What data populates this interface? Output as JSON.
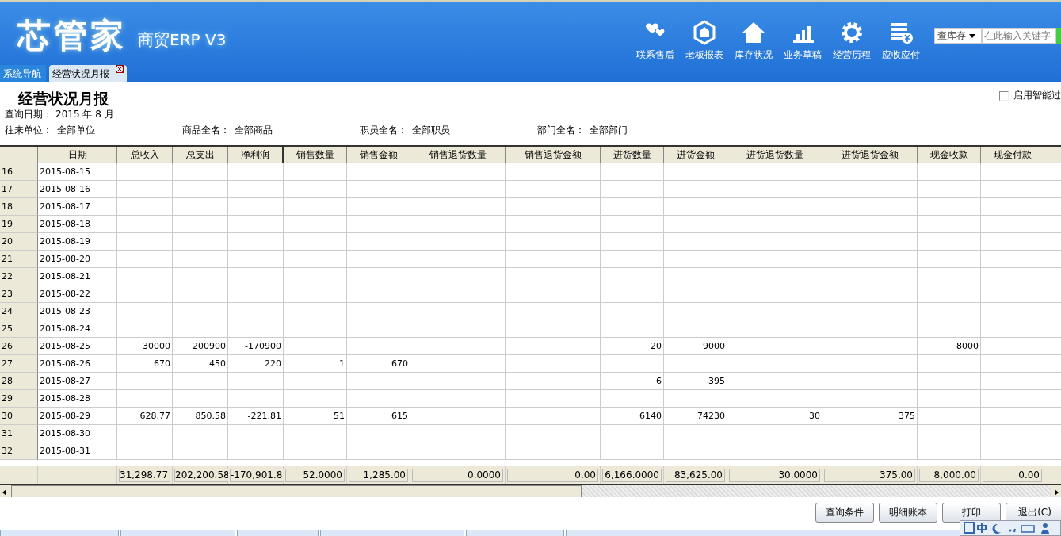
{
  "header": {
    "logo": "芯管家",
    "product": "商贸ERP V3",
    "toolbar": [
      {
        "label": "联系售后"
      },
      {
        "label": "老板报表"
      },
      {
        "label": "库存状况"
      },
      {
        "label": "业务草稿"
      },
      {
        "label": "经营历程"
      },
      {
        "label": "应收应付"
      }
    ],
    "search": {
      "scope": "查库存",
      "placeholder": "在此输入关键字"
    }
  },
  "tabs": [
    {
      "label": "系统导航",
      "selected": false,
      "closable": false
    },
    {
      "label": "经营状况月报",
      "selected": true,
      "closable": true
    }
  ],
  "report": {
    "title": "经营状况月报",
    "smart_filter": {
      "label": "启用智能过",
      "checked": false
    },
    "query_date": {
      "label": "查询日期：",
      "value": "2015 年 8 月"
    },
    "filters": [
      {
        "label": "往来单位：",
        "value": "全部单位"
      },
      {
        "label": "商品全名：",
        "value": "全部商品"
      },
      {
        "label": "职员全名：",
        "value": "全部职员"
      },
      {
        "label": "部门全名：",
        "value": "全部部门"
      }
    ]
  },
  "table": {
    "columns": [
      "日期",
      "总收入",
      "总支出",
      "净利润",
      "销售数量",
      "销售金额",
      "销售退货数量",
      "销售退货金额",
      "进货数量",
      "进货金额",
      "进货退货数量",
      "进货退货金额",
      "现金收款",
      "现金付款"
    ],
    "rows": [
      {
        "number": "16",
        "cells": [
          "2015-08-15",
          null,
          null,
          null,
          null,
          null,
          null,
          null,
          null,
          null,
          null,
          null,
          null,
          null
        ]
      },
      {
        "number": "17",
        "cells": [
          "2015-08-16",
          null,
          null,
          null,
          null,
          null,
          null,
          null,
          null,
          null,
          null,
          null,
          null,
          null
        ]
      },
      {
        "number": "18",
        "cells": [
          "2015-08-17",
          null,
          null,
          null,
          null,
          null,
          null,
          null,
          null,
          null,
          null,
          null,
          null,
          null
        ]
      },
      {
        "number": "19",
        "cells": [
          "2015-08-18",
          null,
          null,
          null,
          null,
          null,
          null,
          null,
          null,
          null,
          null,
          null,
          null,
          null
        ]
      },
      {
        "number": "20",
        "cells": [
          "2015-08-19",
          null,
          null,
          null,
          null,
          null,
          null,
          null,
          null,
          null,
          null,
          null,
          null,
          null
        ]
      },
      {
        "number": "21",
        "cells": [
          "2015-08-20",
          null,
          null,
          null,
          null,
          null,
          null,
          null,
          null,
          null,
          null,
          null,
          null,
          null
        ]
      },
      {
        "number": "22",
        "cells": [
          "2015-08-21",
          null,
          null,
          null,
          null,
          null,
          null,
          null,
          null,
          null,
          null,
          null,
          null,
          null
        ]
      },
      {
        "number": "23",
        "cells": [
          "2015-08-22",
          null,
          null,
          null,
          null,
          null,
          null,
          null,
          null,
          null,
          null,
          null,
          null,
          null
        ]
      },
      {
        "number": "24",
        "cells": [
          "2015-08-23",
          null,
          null,
          null,
          null,
          null,
          null,
          null,
          null,
          null,
          null,
          null,
          null,
          null
        ]
      },
      {
        "number": "25",
        "cells": [
          "2015-08-24",
          null,
          null,
          null,
          null,
          null,
          null,
          null,
          null,
          null,
          null,
          null,
          null,
          null
        ]
      },
      {
        "number": "26",
        "cells": [
          "2015-08-25",
          "30000",
          "200900",
          "-170900",
          null,
          null,
          null,
          null,
          "20",
          "9000",
          null,
          null,
          "8000",
          null
        ]
      },
      {
        "number": "27",
        "cells": [
          "2015-08-26",
          "670",
          "450",
          "220",
          "1",
          "670",
          null,
          null,
          null,
          null,
          null,
          null,
          null,
          null
        ]
      },
      {
        "number": "28",
        "cells": [
          "2015-08-27",
          null,
          null,
          null,
          null,
          null,
          null,
          null,
          "6",
          "395",
          null,
          null,
          null,
          null
        ]
      },
      {
        "number": "29",
        "cells": [
          "2015-08-28",
          null,
          null,
          null,
          null,
          null,
          null,
          null,
          null,
          null,
          null,
          null,
          null,
          null
        ]
      },
      {
        "number": "30",
        "cells": [
          "2015-08-29",
          "628.77",
          "850.58",
          "-221.81",
          "51",
          "615",
          null,
          null,
          "6140",
          "74230",
          "30",
          "375",
          null,
          null
        ]
      },
      {
        "number": "31",
        "cells": [
          "2015-08-30",
          null,
          null,
          null,
          null,
          null,
          null,
          null,
          null,
          null,
          null,
          null,
          null,
          null
        ]
      },
      {
        "number": "32",
        "cells": [
          "2015-08-31",
          null,
          null,
          null,
          null,
          null,
          null,
          null,
          null,
          null,
          null,
          null,
          null,
          null
        ]
      }
    ],
    "totals": [
      "31,298.77",
      "202,200.58",
      "-170,901.8",
      "52.0000",
      "1,285.00",
      "0.0000",
      "0.00",
      "6,166.0000",
      "83,625.00",
      "30.0000",
      "375.00",
      "8,000.00",
      "0.00"
    ]
  },
  "buttons": [
    "查询条件",
    "明细账本",
    "打印",
    "退出(C)"
  ]
}
